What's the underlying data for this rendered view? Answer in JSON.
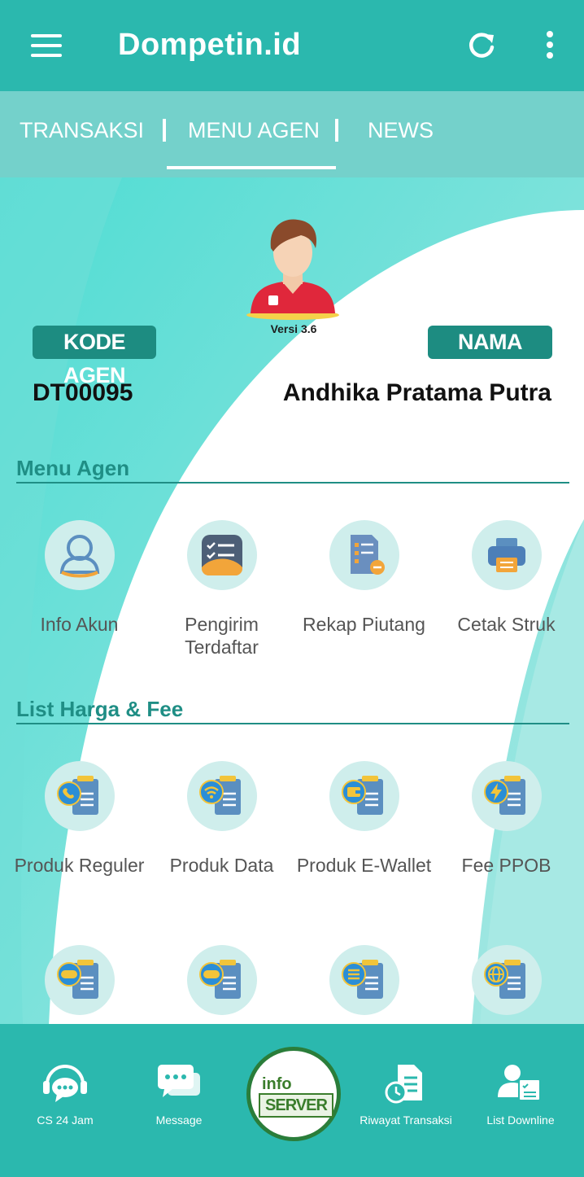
{
  "app": {
    "title": "Dompetin.id"
  },
  "tabs": [
    {
      "label": "TRANSAKSI"
    },
    {
      "label": "MENU AGEN"
    },
    {
      "label": "NEWS"
    }
  ],
  "profile": {
    "version": "Versi 3.6",
    "kode_label": "KODE AGEN",
    "kode_value": "DT00095",
    "nama_label": "NAMA AGEN",
    "nama_value": "Andhika Pratama Putra"
  },
  "sections": {
    "menu_agen": {
      "title": "Menu Agen",
      "items": [
        {
          "label": "Info Akun",
          "icon": "user-icon"
        },
        {
          "label": "Pengirim Terdaftar",
          "icon": "checklist-icon"
        },
        {
          "label": "Rekap Piutang",
          "icon": "report-icon"
        },
        {
          "label": "Cetak Struk",
          "icon": "printer-icon"
        }
      ]
    },
    "list_harga": {
      "title": "List Harga & Fee",
      "items": [
        {
          "label": "Produk Reguler",
          "icon": "phone-list-icon"
        },
        {
          "label": "Produk Data",
          "icon": "wifi-list-icon"
        },
        {
          "label": "Produk E-Wallet",
          "icon": "wallet-list-icon"
        },
        {
          "label": "Fee PPOB",
          "icon": "bolt-list-icon"
        },
        {
          "label": "",
          "icon": "gamepad-list-icon"
        },
        {
          "label": "",
          "icon": "gamepad-list-icon"
        },
        {
          "label": "",
          "icon": "menu-list-icon"
        },
        {
          "label": "",
          "icon": "globe-list-icon"
        }
      ]
    }
  },
  "bottom_nav": {
    "cs": "CS 24 Jam",
    "message": "Message",
    "info_top": "info",
    "info_bottom": "SERVER",
    "riwayat": "Riwayat Transaksi",
    "downline": "List Downline"
  },
  "colors": {
    "primary": "#2bb8ae",
    "accent_dark": "#1d8c81",
    "icon_bg": "#cfeeec"
  }
}
